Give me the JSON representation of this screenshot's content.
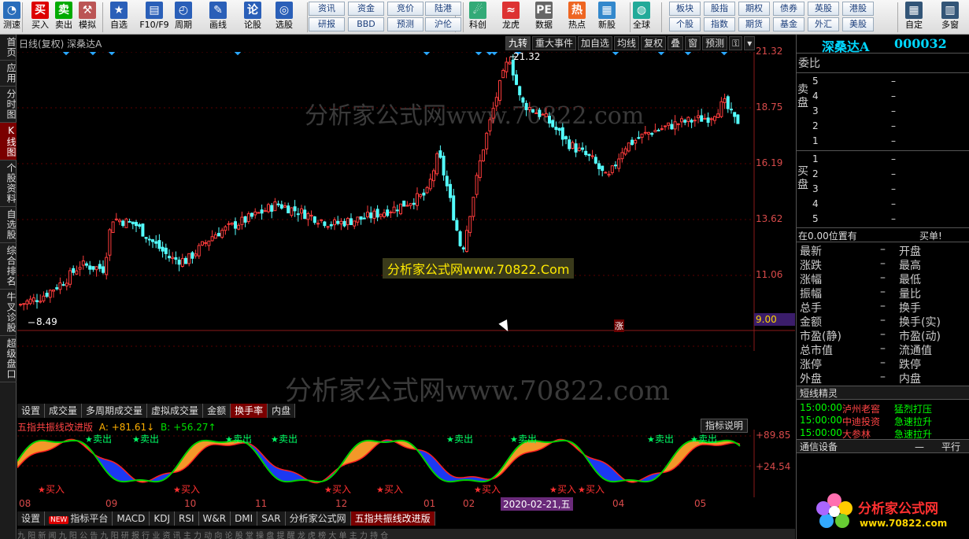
{
  "toolbar": {
    "buttons": [
      {
        "label": "测速",
        "icon": "gauge-icon"
      },
      {
        "label": "买入",
        "icon": "buy-icon"
      },
      {
        "label": "卖出",
        "icon": "sell-icon"
      },
      {
        "label": "模拟",
        "icon": "hammer-icon"
      },
      {
        "label": "自选",
        "icon": "star-icon"
      },
      {
        "label": "F10/F9",
        "icon": "f10-icon"
      },
      {
        "label": "周期",
        "icon": "clock-icon"
      },
      {
        "label": "画线",
        "icon": "pen-icon"
      },
      {
        "label": "论股",
        "icon": "discuss-icon"
      },
      {
        "label": "选股",
        "icon": "search-icon"
      },
      {
        "label": "科创",
        "icon": "chart-icon"
      },
      {
        "label": "龙虎",
        "icon": "dragon-icon"
      },
      {
        "label": "数据",
        "icon": "pe-icon"
      },
      {
        "label": "热点",
        "icon": "hot-icon"
      },
      {
        "label": "新股",
        "icon": "ipo-icon"
      },
      {
        "label": "全球",
        "icon": "globe-icon"
      },
      {
        "label": "自定",
        "icon": "custom-icon"
      },
      {
        "label": "多窗",
        "icon": "windows-icon"
      }
    ],
    "text_buttons": [
      {
        "label": "资讯"
      },
      {
        "label": "资金"
      },
      {
        "label": "竞价"
      },
      {
        "label": "陆港"
      },
      {
        "label": "研报"
      },
      {
        "label": "BBD"
      },
      {
        "label": "预测"
      },
      {
        "label": "沪伦"
      },
      {
        "label": "板块"
      },
      {
        "label": "股指"
      },
      {
        "label": "期权"
      },
      {
        "label": "债券"
      },
      {
        "label": "英股"
      },
      {
        "label": "港股"
      },
      {
        "label": "个股"
      },
      {
        "label": "指数"
      },
      {
        "label": "期货"
      },
      {
        "label": "基金"
      },
      {
        "label": "外汇"
      },
      {
        "label": "美股"
      }
    ]
  },
  "sidebar": {
    "items": [
      {
        "label": "首页"
      },
      {
        "label": "应用"
      },
      {
        "label": "分时图"
      },
      {
        "label": "K线图"
      },
      {
        "label": "个股资料"
      },
      {
        "label": "自选股"
      },
      {
        "label": "综合排名"
      },
      {
        "label": "牛叉诊股"
      },
      {
        "label": "超级盘口"
      }
    ]
  },
  "kline": {
    "info": "日线(复权) 深桑达A",
    "tools": [
      "九转",
      "重大事件",
      "加自选",
      "均线",
      "复权",
      "叠",
      "窗",
      "预测",
      "⚿",
      "▾"
    ],
    "high_label": "21.32",
    "low_label": "8.49",
    "yaxis": [
      "21.32",
      "18.75",
      "16.19",
      "13.62",
      "11.06",
      "9.00"
    ],
    "last_price": "9.00",
    "limit_tag": "涨"
  },
  "watermark": {
    "upper": "分析家公式网www.70822.com",
    "lower": "分析家公式网www.70822.com",
    "banner": "分析家公式网www.70822.Com"
  },
  "tabs1": [
    "设置",
    "成交量",
    "多周期成交量",
    "虚拟成交量",
    "金额",
    "换手率",
    "内盘"
  ],
  "indicator": {
    "title": "五指共振线改进版",
    "a": "A: +81.61↓",
    "b": "B: +56.27↑",
    "help": "指标说明",
    "yaxis": [
      "+89.85",
      "+24.54"
    ],
    "sell": "卖出",
    "buy": "买入"
  },
  "xaxis": [
    "08",
    "09",
    "10",
    "11",
    "12",
    "01",
    "02",
    "03",
    "04",
    "05"
  ],
  "date_badge": "2020-02-21,五",
  "tabs2": [
    "设置",
    "指标平台",
    "MACD",
    "KDJ",
    "RSI",
    "W&R",
    "DMI",
    "SAR",
    "分析家公式网",
    "五指共振线改进版"
  ],
  "tabs2_new": "NEW",
  "tabs3": "九 阳 新 闻    九 阳 公 告    九 阳 研 报    行 业 资 讯    主 力 动 向    论 股 堂    操 盘 提 醒    龙 虎 榜 大 单    主 力 持 仓",
  "stock": {
    "name": "深桑达A",
    "code": "000032"
  },
  "orderbook": {
    "weibi": "委比",
    "sell_side": "卖盘",
    "buy_side": "买盘",
    "sell": [
      {
        "level": "5",
        "val": "–"
      },
      {
        "level": "4",
        "val": "–"
      },
      {
        "level": "3",
        "val": "–"
      },
      {
        "level": "2",
        "val": "–"
      },
      {
        "level": "1",
        "val": "–"
      }
    ],
    "buy": [
      {
        "level": "1",
        "val": "–"
      },
      {
        "level": "2",
        "val": "–"
      },
      {
        "level": "3",
        "val": "–"
      },
      {
        "level": "4",
        "val": "–"
      },
      {
        "level": "5",
        "val": "–"
      }
    ],
    "position_text": "在0.00位置有",
    "buy_text": "买单!"
  },
  "stats": [
    {
      "l": "最新",
      "r": "开盘"
    },
    {
      "l": "涨跌",
      "r": "最高"
    },
    {
      "l": "涨幅",
      "r": "最低"
    },
    {
      "l": "振幅",
      "r": "量比"
    },
    {
      "l": "总手",
      "r": "换手"
    },
    {
      "l": "金额",
      "r": "换手(实)"
    },
    {
      "l": "市盈(静)",
      "r": "市盈(动)"
    },
    {
      "l": "总市值",
      "r": "流通值"
    },
    {
      "l": "涨停",
      "r": "跌停"
    },
    {
      "l": "外盘",
      "r": "内盘"
    }
  ],
  "elf": {
    "title": "短线精灵",
    "rows": [
      {
        "time": "15:00:00",
        "name": "泸州老窖",
        "signal": "猛烈打压"
      },
      {
        "time": "15:00:00",
        "name": "中迪投资",
        "signal": "急速拉升"
      },
      {
        "time": "15:00:00",
        "name": "大参林",
        "signal": "急速拉升"
      }
    ]
  },
  "comm": {
    "label": "通信设备",
    "p1": "—",
    "p2": "平行"
  },
  "logo": {
    "text": "分析家公式网",
    "url": "www.70822.com"
  },
  "colors": {
    "up": "#ff3c3c",
    "down": "#54ffff",
    "axis": "#d84a4a",
    "grid": "#8a1a1a",
    "orange": "#ff9d1e",
    "blue": "#1e3cff",
    "green": "#00d000"
  }
}
